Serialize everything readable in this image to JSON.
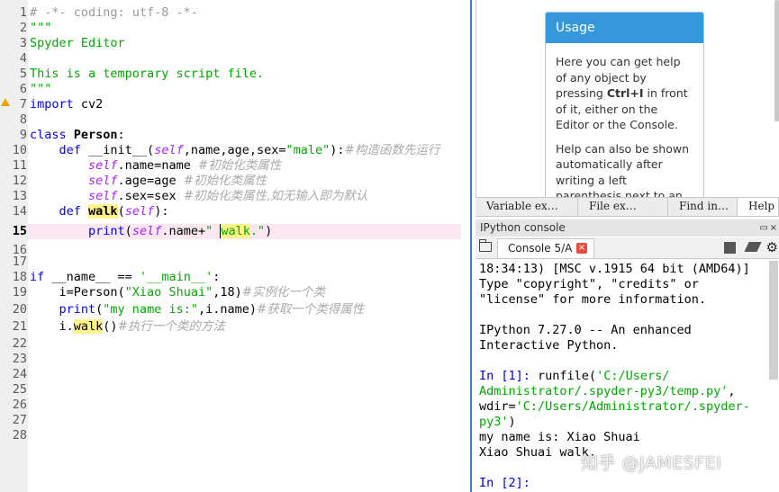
{
  "editor": {
    "line_numbers": [
      "1",
      "2",
      "3",
      "4",
      "5",
      "6",
      "7",
      "8",
      "9",
      "10",
      "11",
      "12",
      "13",
      "14",
      "15",
      "16",
      "17",
      "18",
      "19",
      "20",
      "21",
      "22",
      "23",
      "24",
      "25",
      "26",
      "27",
      "28"
    ],
    "current_line": "15",
    "lines": {
      "l1": "# -*- coding: utf-8 -*-",
      "l2": "\"\"\"",
      "l3": "Spyder Editor",
      "l5": "This is a temporary script file.",
      "l6": "\"\"\"",
      "l7_kw": "import",
      "l7_rest": " cv2",
      "l9_kw": "class",
      "l9_name": " Person",
      "l9_rest": ":",
      "l10_kw": "def",
      "l10_a": " __init__(",
      "l10_self": "self",
      "l10_b": ",name,age,sex=",
      "l10_str": "\"male\"",
      "l10_c": "):",
      "l10_cmt": "#构造函数先运行",
      "l11_self": "self",
      "l11_a": ".name=name ",
      "l11_cmt": "#初始化类属性",
      "l12_self": "self",
      "l12_a": ".age=age ",
      "l12_cmt": "#初始化类属性",
      "l13_self": "self",
      "l13_a": ".sex=sex ",
      "l13_cmt": "#初始化类属性,如无输入即为默认",
      "l14_kw": "def",
      "l14_name": "walk",
      "l14_a": "(",
      "l14_self": "self",
      "l14_b": "):",
      "l15_kw": "print",
      "l15_a": "(",
      "l15_self": "self",
      "l15_b": ".name+",
      "l15_str1": "\" ",
      "l15_hl": "walk",
      "l15_str2": ".\"",
      "l15_c": ")",
      "l18_kw": "if",
      "l18_a": " __name__ == ",
      "l18_str": "'__main__'",
      "l18_b": ":",
      "l19_a": "i=Person(",
      "l19_str": "\"Xiao Shuai\"",
      "l19_b": ",18)",
      "l19_cmt": "#实例化一个类",
      "l20_kw": "print",
      "l20_a": "(",
      "l20_str": "\"my name is:\"",
      "l20_b": ",i.name)",
      "l20_cmt": "#获取一个类得属性",
      "l21_a": "i.",
      "l21_hl": "walk",
      "l21_b": "()",
      "l21_cmt": "#执行一个类的方法"
    }
  },
  "help": {
    "usage_title": "Usage",
    "para1_a": "Here you can get help of any object by pressing ",
    "para1_key": "Ctrl+I",
    "para1_b": " in front of it, either on the Editor or the Console.",
    "para2": "Help can also be shown automatically after writing a left parenthesis next to an object. You",
    "tabs": [
      "Variable ex…",
      "File ex…",
      "Find in…",
      "Help"
    ]
  },
  "console": {
    "pane_title": "IPython console",
    "tab_label": "Console 5/A",
    "tab_close": "×",
    "lines": {
      "c0": "18:34:13) [MSC v.1915 64 bit (AMD64)]",
      "c1": "Type \"copyright\", \"credits\" or",
      "c2": "\"license\" for more information.",
      "c4": "IPython 7.27.0 -- An enhanced",
      "c5": "Interactive Python.",
      "c7_prompt": "In [1]:",
      "c7_a": " runfile(",
      "c7_str": "'C:/Users/",
      "c8_str": "Administrator/.spyder-py3/temp.py'",
      "c8_b": ",",
      "c9_a": "wdir=",
      "c9_str": "'C:/Users/Administrator/.spyder-",
      "c10_str": "py3'",
      "c10_b": ")",
      "c11": "my name is: Xiao Shuai",
      "c12": "Xiao Shuai walk.",
      "c14_prompt": "In [2]:"
    }
  },
  "watermark": "知乎 @JAMESFEI",
  "colors": {
    "keyword": "#0000ff",
    "string": "#00aa00",
    "self": "#aa22ff",
    "comment": "#999999",
    "usage_header": "#3498db",
    "current_line": "#fbe7ef",
    "occurrence_highlight": "#fff48a"
  }
}
